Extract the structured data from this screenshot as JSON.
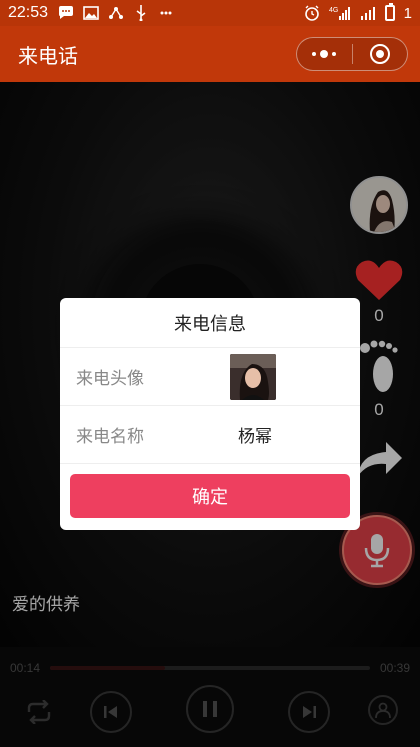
{
  "status_bar": {
    "time": "22:53",
    "battery_level": "1",
    "network": "4G"
  },
  "titlebar": {
    "title": "来电话"
  },
  "side_actions": {
    "likes": "0",
    "footprints": "0"
  },
  "song": {
    "title": "爱的供养"
  },
  "player": {
    "current_time": "00:14",
    "total_time": "00:39",
    "progress": 0.36
  },
  "dialog": {
    "title": "来电信息",
    "avatar_label": "来电头像",
    "name_label": "来电名称",
    "name_value": "杨幂",
    "confirm_label": "确定"
  },
  "colors": {
    "brand": "#c1380a",
    "confirm": "#ee3f5f",
    "heart": "#ff3333",
    "mic": "#e8434a"
  }
}
